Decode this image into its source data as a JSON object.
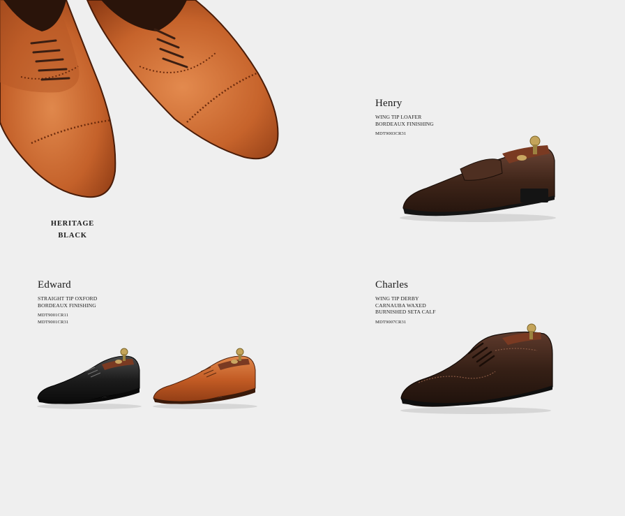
{
  "heritage": {
    "line1": "HERITAGE",
    "line2": "BLACK"
  },
  "products": {
    "henry": {
      "name": "Henry",
      "desc": [
        "WING TIP LOAFER",
        "BORDEAUX FINISHING"
      ],
      "codes": [
        "MDT9003CR31"
      ]
    },
    "edward": {
      "name": "Edward",
      "desc": [
        "STRAIGHT TIP OXFORD",
        "BORDEAUX FINISHING"
      ],
      "codes": [
        "MDT9001CR11",
        "MDT9001CR31"
      ]
    },
    "charles": {
      "name": "Charles",
      "desc": [
        "WING TIP DERBY",
        "CARNAUBA WAXED",
        "BURNISHED SETA CALF"
      ],
      "codes": [
        "MDT9007CR31"
      ]
    }
  },
  "colors": {
    "background": "#efefef",
    "tan": "#b5521f",
    "dark_brown": "#3b241c",
    "black": "#151515"
  }
}
